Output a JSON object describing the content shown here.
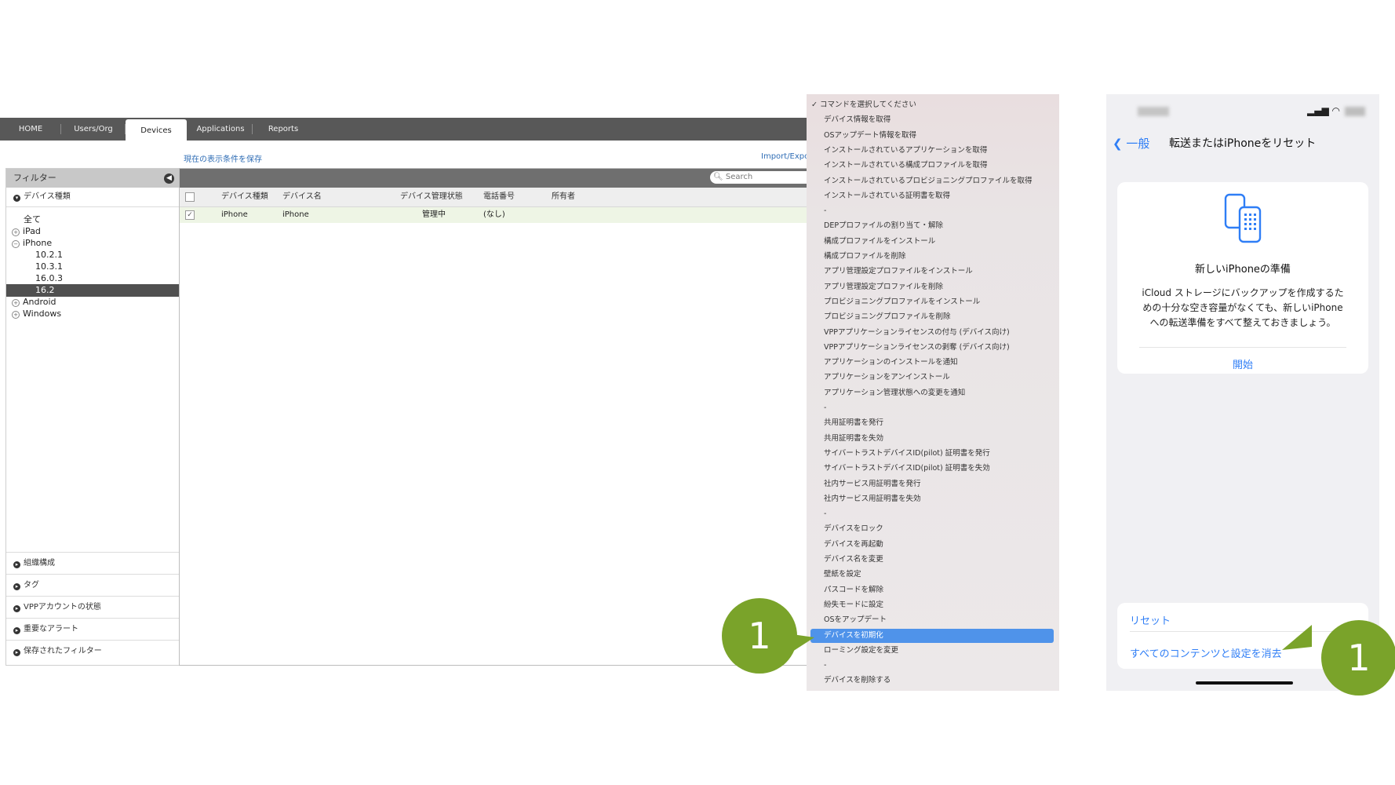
{
  "console": {
    "tabs": [
      {
        "label": "HOME",
        "active": false
      },
      {
        "label": "Users/Org",
        "active": false
      },
      {
        "label": "Devices",
        "active": true
      },
      {
        "label": "Applications",
        "active": false
      },
      {
        "label": "Reports",
        "active": false
      }
    ],
    "save_link": "現在の表示条件を保存",
    "import_link": "Import/Expo",
    "filter": {
      "title": "フィルター",
      "device_type_section": "デバイス種類",
      "tree": [
        {
          "label": "全て",
          "level": 0,
          "expander": false,
          "selected": false
        },
        {
          "label": "iPad",
          "level": 0,
          "expander": true,
          "selected": false
        },
        {
          "label": "iPhone",
          "level": 0,
          "expander": true,
          "selected": false
        },
        {
          "label": "10.2.1",
          "level": 1,
          "expander": false,
          "selected": false
        },
        {
          "label": "10.3.1",
          "level": 1,
          "expander": false,
          "selected": false
        },
        {
          "label": "16.0.3",
          "level": 1,
          "expander": false,
          "selected": false
        },
        {
          "label": "16.2",
          "level": 1,
          "expander": false,
          "selected": true
        },
        {
          "label": "Android",
          "level": 0,
          "expander": true,
          "selected": false
        },
        {
          "label": "Windows",
          "level": 0,
          "expander": true,
          "selected": false
        }
      ],
      "bottom_sections": [
        "組織構成",
        "タグ",
        "VPPアカウントの状態",
        "重要なアラート",
        "保存されたフィルター"
      ]
    },
    "search_placeholder": "Search",
    "table": {
      "headers": [
        "デバイス種類",
        "デバイス名",
        "デバイス管理状態",
        "電話番号",
        "所有者"
      ],
      "rows": [
        {
          "checked": true,
          "device_type": "iPhone",
          "device_name": "iPhone",
          "state": "管理中",
          "phone": "(なし)",
          "owner": ""
        }
      ]
    }
  },
  "command_menu": {
    "items": [
      {
        "label": "コマンドを選択してください",
        "checked": true
      },
      {
        "label": "デバイス情報を取得"
      },
      {
        "label": "OSアップデート情報を取得"
      },
      {
        "label": "インストールされているアプリケーションを取得"
      },
      {
        "label": "インストールされている構成プロファイルを取得"
      },
      {
        "label": "インストールされているプロビジョニングプロファイルを取得"
      },
      {
        "label": "インストールされている証明書を取得"
      },
      {
        "label": "-"
      },
      {
        "label": "DEPプロファイルの割り当て・解除"
      },
      {
        "label": "構成プロファイルをインストール"
      },
      {
        "label": "構成プロファイルを削除"
      },
      {
        "label": "アプリ管理設定プロファイルをインストール"
      },
      {
        "label": "アプリ管理設定プロファイルを削除"
      },
      {
        "label": "プロビジョニングプロファイルをインストール"
      },
      {
        "label": "プロビジョニングプロファイルを削除"
      },
      {
        "label": "VPPアプリケーションライセンスの付与 (デバイス向け)"
      },
      {
        "label": "VPPアプリケーションライセンスの剥奪 (デバイス向け)"
      },
      {
        "label": "アプリケーションのインストールを通知"
      },
      {
        "label": "アプリケーションをアンインストール"
      },
      {
        "label": "アプリケーション管理状態への変更を通知"
      },
      {
        "label": "-"
      },
      {
        "label": "共用証明書を発行"
      },
      {
        "label": "共用証明書を失効"
      },
      {
        "label": "サイバートラストデバイスID(pilot) 証明書を発行"
      },
      {
        "label": "サイバートラストデバイスID(pilot) 証明書を失効"
      },
      {
        "label": "社内サービス用証明書を発行"
      },
      {
        "label": "社内サービス用証明書を失効"
      },
      {
        "label": "-"
      },
      {
        "label": "デバイスをロック"
      },
      {
        "label": "デバイスを再起動"
      },
      {
        "label": "デバイス名を変更"
      },
      {
        "label": "壁紙を設定"
      },
      {
        "label": "パスコードを解除"
      },
      {
        "label": "紛失モードに設定"
      },
      {
        "label": "OSをアップデート"
      },
      {
        "label": "デバイスを初期化",
        "highlighted": true
      },
      {
        "label": "ローミング設定を変更"
      },
      {
        "label": "-"
      },
      {
        "label": "デバイスを削除する"
      }
    ]
  },
  "phone": {
    "back_label": "一般",
    "title": "転送またはiPhoneをリセット",
    "prepare_title": "新しいiPhoneの準備",
    "prepare_body": "iCloud ストレージにバックアップを作成するた\nめの十分な空き容量がなくても、新しいiPhone\nへの転送準備をすべて整えておきましょう。",
    "start_label": "開始",
    "reset_label": "リセット",
    "erase_label": "すべてのコンテンツと設定を消去"
  },
  "callouts": [
    "1",
    "1"
  ],
  "colors": {
    "nav_bar": "#585858",
    "menu_highlight": "#4f93ea",
    "ios_link": "#2f7ef6",
    "callout": "#7aa32a"
  }
}
